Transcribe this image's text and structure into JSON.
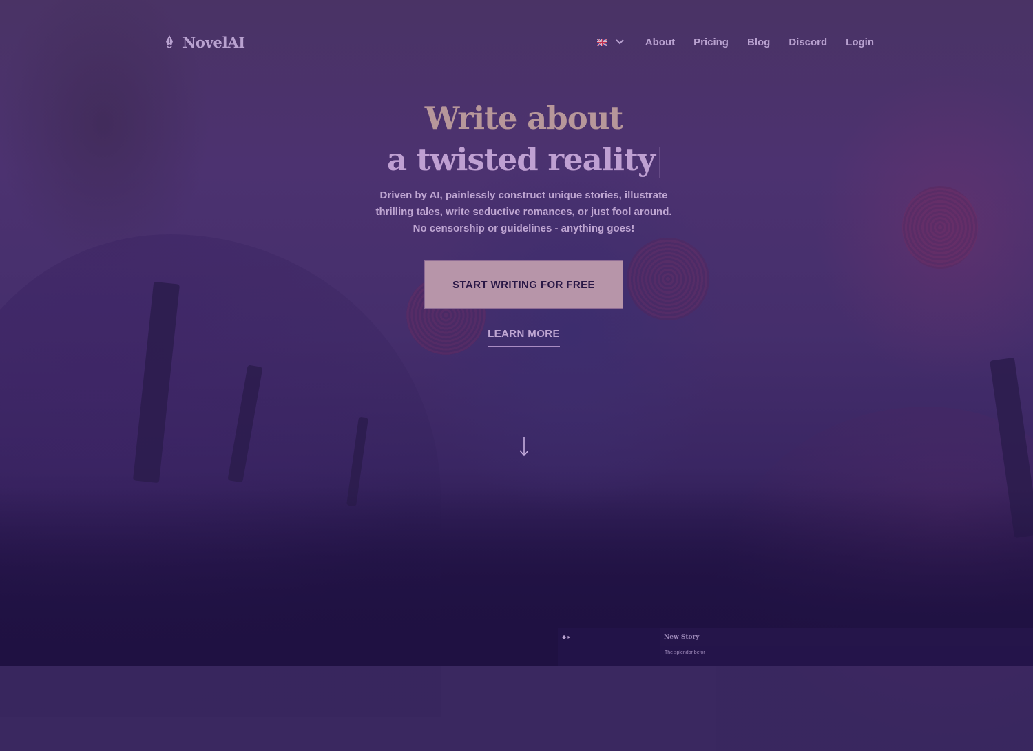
{
  "nav": {
    "brand": "NovelAI",
    "brand_icon": "quill-pen-icon",
    "language": {
      "icon": "uk-flag-icon",
      "selected": "English"
    },
    "links": [
      {
        "label": "About"
      },
      {
        "label": "Pricing"
      },
      {
        "label": "Blog"
      },
      {
        "label": "Discord"
      },
      {
        "label": "Login"
      }
    ]
  },
  "hero": {
    "title_line1": "Write about",
    "title_line2": "a twisted reality",
    "subtitle": "Driven by AI, painlessly construct unique stories, illustrate thrilling tales, write seductive romances, or just fool around. No censorship or guidelines - anything goes!",
    "cta_label": "START WRITING FOR FREE",
    "learn_more_label": "LEARN MORE",
    "scroll_icon": "arrow-down-icon"
  },
  "preview": {
    "controls": "◆ ▸",
    "title": "New Story",
    "text": "The splendor befor"
  },
  "colors": {
    "background": "#452e6c",
    "accent": "#b795a9",
    "text": "#b9a2d0"
  }
}
